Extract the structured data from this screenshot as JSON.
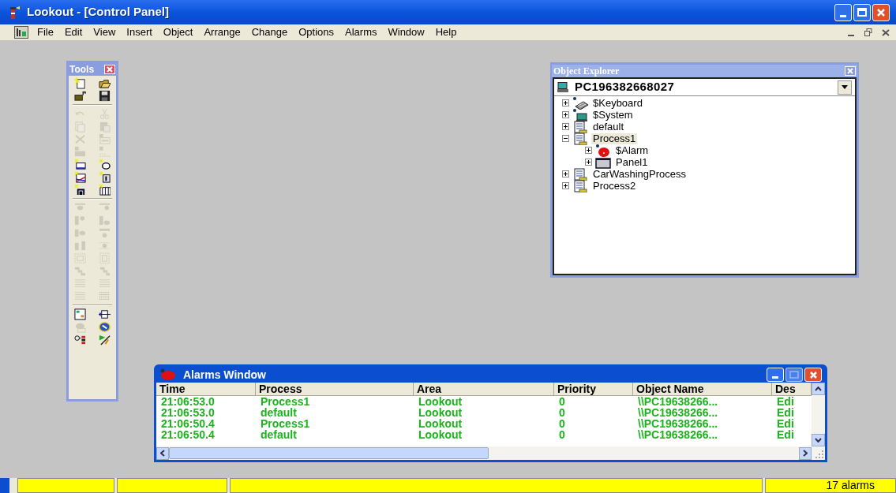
{
  "window": {
    "title": "Lookout - [Control Panel]"
  },
  "menu": [
    "File",
    "Edit",
    "View",
    "Insert",
    "Object",
    "Arrange",
    "Change",
    "Options",
    "Alarms",
    "Window",
    "Help"
  ],
  "tools": {
    "title": "Tools",
    "groups": [
      [
        {
          "kind": "new",
          "disabled": false
        },
        {
          "kind": "open",
          "disabled": false
        },
        {
          "kind": "folder",
          "disabled": false
        },
        {
          "kind": "save",
          "disabled": false
        }
      ],
      [
        {
          "kind": "undo",
          "disabled": true
        },
        {
          "kind": "cut",
          "disabled": true
        },
        {
          "kind": "copy",
          "disabled": true
        },
        {
          "kind": "paste",
          "disabled": true
        },
        {
          "kind": "delete",
          "disabled": true
        },
        {
          "kind": "text",
          "disabled": true
        },
        {
          "kind": "block",
          "disabled": true
        },
        {
          "kind": "steps",
          "disabled": true
        },
        {
          "kind": "rect",
          "disabled": false
        },
        {
          "kind": "circle",
          "disabled": false
        },
        {
          "kind": "chart",
          "disabled": false
        },
        {
          "kind": "label",
          "disabled": false
        },
        {
          "kind": "node",
          "disabled": false
        },
        {
          "kind": "film",
          "disabled": false
        }
      ],
      [
        {
          "kind": "aligntop",
          "disabled": true
        },
        {
          "kind": "alignbottom",
          "disabled": true
        },
        {
          "kind": "alignleft",
          "disabled": true
        },
        {
          "kind": "alignright",
          "disabled": true
        },
        {
          "kind": "centerh",
          "disabled": true
        },
        {
          "kind": "centerv",
          "disabled": true
        },
        {
          "kind": "spaceh",
          "disabled": true
        },
        {
          "kind": "spacev",
          "disabled": true
        },
        {
          "kind": "sizew",
          "disabled": true
        },
        {
          "kind": "sizeh",
          "disabled": true
        },
        {
          "kind": "front",
          "disabled": true
        },
        {
          "kind": "back",
          "disabled": true
        },
        {
          "kind": "lines",
          "disabled": true
        },
        {
          "kind": "lines",
          "disabled": true
        },
        {
          "kind": "lines",
          "disabled": true
        },
        {
          "kind": "grid",
          "disabled": true
        }
      ],
      [
        {
          "kind": "diagram",
          "disabled": false
        },
        {
          "kind": "connector",
          "disabled": false
        },
        {
          "kind": "cloud",
          "disabled": true
        },
        {
          "kind": "globe",
          "disabled": false
        },
        {
          "kind": "tags",
          "disabled": false
        },
        {
          "kind": "flag",
          "disabled": false
        }
      ]
    ]
  },
  "object_explorer": {
    "title": "Object Explorer",
    "computer": "PC196382668027",
    "tree": [
      {
        "label": "$Keyboard",
        "kind": "keyboard",
        "expanded": false,
        "selected": false
      },
      {
        "label": "$System",
        "kind": "system",
        "expanded": false,
        "selected": false
      },
      {
        "label": "default",
        "kind": "process",
        "expanded": false,
        "selected": false
      },
      {
        "label": "Process1",
        "kind": "process",
        "expanded": true,
        "selected": true,
        "children": [
          {
            "label": "$Alarm",
            "kind": "alarm",
            "expanded": false,
            "selected": false
          },
          {
            "label": "Panel1",
            "kind": "panel",
            "expanded": false,
            "selected": false
          }
        ]
      },
      {
        "label": "CarWashingProcess",
        "kind": "process",
        "expanded": false,
        "selected": false
      },
      {
        "label": "Process2",
        "kind": "process",
        "expanded": false,
        "selected": false
      }
    ]
  },
  "alarms_window": {
    "title": "Alarms Window",
    "columns": [
      "Time",
      "Process",
      "Area",
      "Priority",
      "Object Name",
      "Des"
    ],
    "rows": [
      [
        "21:06:53.0",
        "Process1",
        "Lookout",
        "0",
        "\\\\PC19638266...",
        "Edi"
      ],
      [
        "21:06:53.0",
        "default",
        "Lookout",
        "0",
        "\\\\PC19638266...",
        "Edi"
      ],
      [
        "21:06:50.4",
        "Process1",
        "Lookout",
        "0",
        "\\\\PC19638266...",
        "Edi"
      ],
      [
        "21:06:50.4",
        "default",
        "Lookout",
        "0",
        "\\\\PC19638266...",
        "Edi"
      ]
    ]
  },
  "status_bar": {
    "alarm_count": "17 alarms"
  }
}
